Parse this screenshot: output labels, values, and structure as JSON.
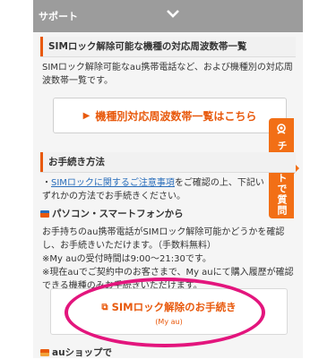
{
  "topbar": {
    "label": "サポート"
  },
  "section1": {
    "title": "SIMロック解除可能な機種の対応周波数帯一覧",
    "desc": "SIMロック解除可能なau携帯電話など、および機種別の対応周波数帯一覧です。",
    "button_label": "機種別対応周波数帯一覧はこちら"
  },
  "chat_tab": {
    "label": "チャットで質問"
  },
  "section2": {
    "title": "お手続き方法",
    "link_text": "SIMロックに関するご注意事項",
    "intro_after_link": "をご確認の上、下記いずれかの方法でお手続きください。",
    "pc_heading": "パソコン・スマートフォンから",
    "pc_line1": "お手持ちのau携帯電話がSIMロック解除可能かどうかを確認し、お手続きいただけます。（手数料無料）",
    "pc_line2": "※My auの受付時間は9:00〜21:30です。",
    "pc_line3": "※現在auでご契約中のお客さまで、My auにて購入履歴が確認できる機種のみお手続きいただけます。",
    "procedure_button_main": "SIMロック解除のお手続き",
    "procedure_button_sub": "(My au)",
    "shop_heading": "auショップで"
  },
  "colors": {
    "accent": "#e8590c",
    "highlight": "#e3157d",
    "link": "#2a6ebb"
  },
  "icons": [
    "chevron-down-icon",
    "play-triangle-icon",
    "operator-icon",
    "computer-icon",
    "open-window-icon"
  ]
}
